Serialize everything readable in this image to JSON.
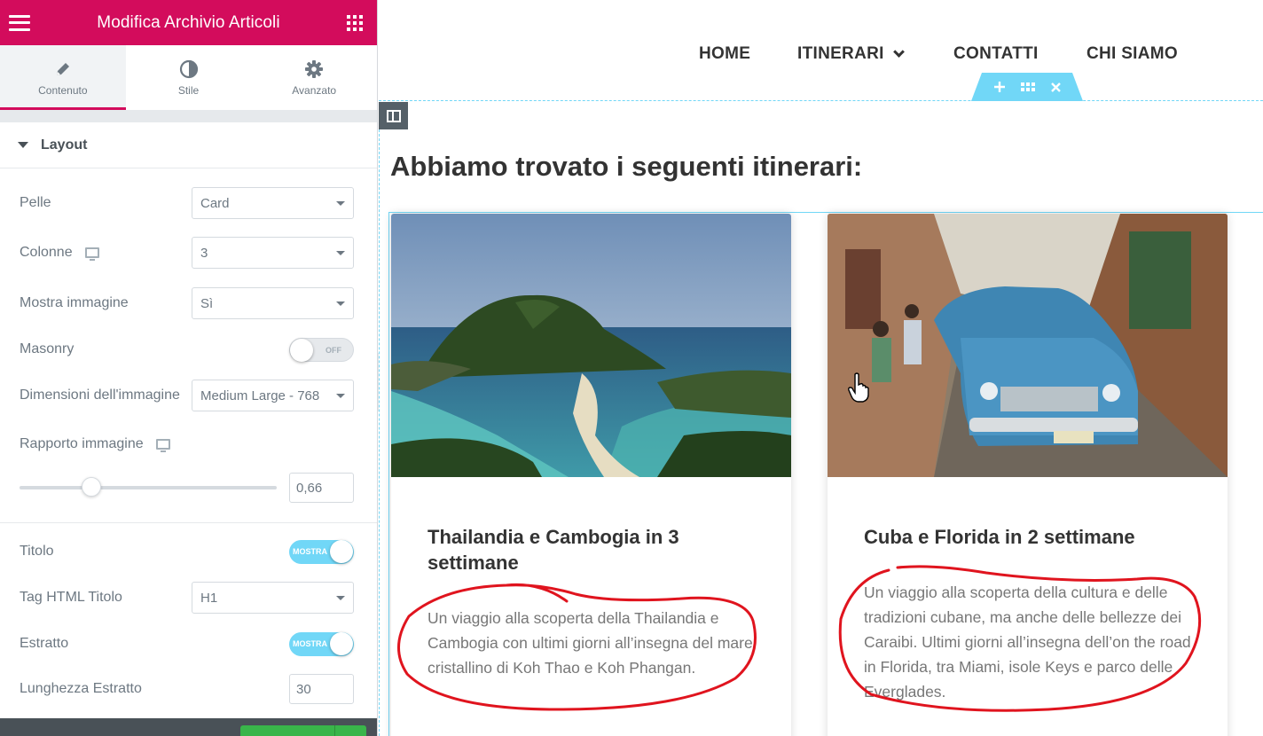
{
  "editor": {
    "title": "Modifica Archivio Articoli",
    "tabs": [
      {
        "label": "Contenuto",
        "icon": "pencil-icon",
        "active": true
      },
      {
        "label": "Stile",
        "icon": "contrast-icon",
        "active": false
      },
      {
        "label": "Avanzato",
        "icon": "gear-icon",
        "active": false
      }
    ],
    "section": "Layout",
    "controls": {
      "pelle": {
        "label": "Pelle",
        "value": "Card"
      },
      "colonne": {
        "label": "Colonne",
        "value": "3"
      },
      "mostra_immagine": {
        "label": "Mostra immagine",
        "value": "Sì"
      },
      "masonry": {
        "label": "Masonry",
        "state": "OFF"
      },
      "dimensioni": {
        "label": "Dimensioni dell'immagine",
        "value": "Medium Large - 768"
      },
      "rapporto": {
        "label": "Rapporto immagine",
        "value": "0,66",
        "fraction": 0.28
      },
      "titolo": {
        "label": "Titolo",
        "state": "MOSTRA"
      },
      "tag_html": {
        "label": "Tag HTML Titolo",
        "value": "H1"
      },
      "estratto": {
        "label": "Estratto",
        "state": "MOSTRA"
      },
      "lunghezza": {
        "label": "Lunghezza Estratto",
        "value": "30"
      }
    }
  },
  "site": {
    "nav": [
      {
        "label": "HOME"
      },
      {
        "label": "ITINERARI",
        "has_dropdown": true
      },
      {
        "label": "CONTATTI"
      },
      {
        "label": "CHI SIAMO"
      }
    ],
    "heading": "Abbiamo trovato i seguenti itinerari:",
    "posts": [
      {
        "title": "Thailandia e Cambogia in 3 settimane",
        "excerpt": "Un viaggio alla scoperta della Thailandia e Cambogia con ultimi giorni all’insegna del mare cristallino di Koh Thao e Koh Phangan."
      },
      {
        "title": "Cuba e Florida in 2 settimane",
        "excerpt": "Un viaggio alla scoperta della cultura e delle tradizioni cubane, ma anche delle bellezze dei Caraibi. Ultimi giorni all’insegna dell’on the road in Florida, tra Miami, isole Keys e parco delle Everglades."
      }
    ]
  },
  "colors": {
    "brand": "#d30c5c",
    "accent": "#71d7f7",
    "annotation": "#e0141e"
  }
}
